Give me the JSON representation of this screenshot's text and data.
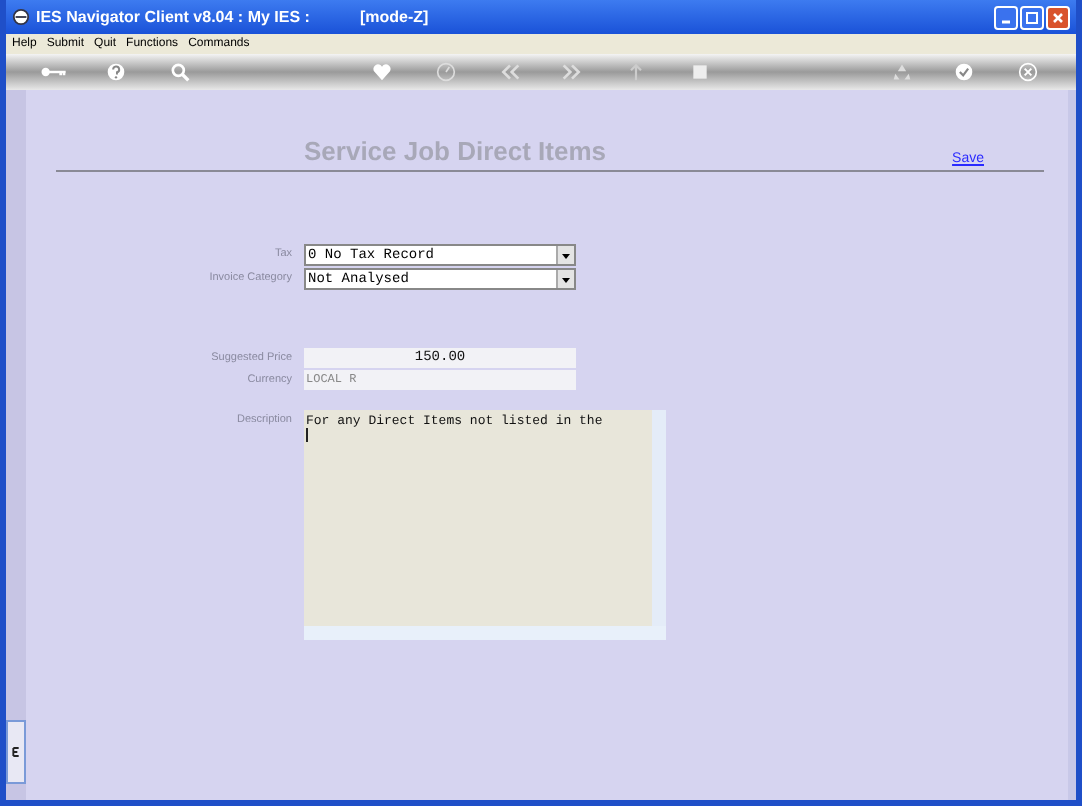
{
  "window": {
    "title": "IES Navigator Client v8.04 : My IES :",
    "mode": "[mode-Z]"
  },
  "menu": [
    "Help",
    "Submit",
    "Quit",
    "Functions",
    "Commands"
  ],
  "toolbar": [
    {
      "kind": "key"
    },
    {
      "kind": "help"
    },
    {
      "kind": "search"
    },
    {
      "kind": "gap"
    },
    {
      "kind": "heart"
    },
    {
      "kind": "clock"
    },
    {
      "kind": "back"
    },
    {
      "kind": "forward"
    },
    {
      "kind": "up"
    },
    {
      "kind": "stop"
    },
    {
      "kind": "gap"
    },
    {
      "kind": "recycle"
    },
    {
      "kind": "check"
    },
    {
      "kind": "close"
    }
  ],
  "page": {
    "title": "Service Job Direct Items",
    "save": "Save"
  },
  "fields": [
    {
      "kind": "select",
      "label": "Tax",
      "value": "0 No Tax Record"
    },
    {
      "kind": "select",
      "label": "Invoice Category",
      "value": "Not Analysed"
    },
    {
      "kind": "number",
      "label": "Suggested Price",
      "value": "150.00"
    },
    {
      "kind": "text",
      "label": "Currency",
      "value": "LOCAL R"
    },
    {
      "kind": "textarea",
      "label": "Description",
      "value": "For any Direct Items not listed in the"
    }
  ]
}
